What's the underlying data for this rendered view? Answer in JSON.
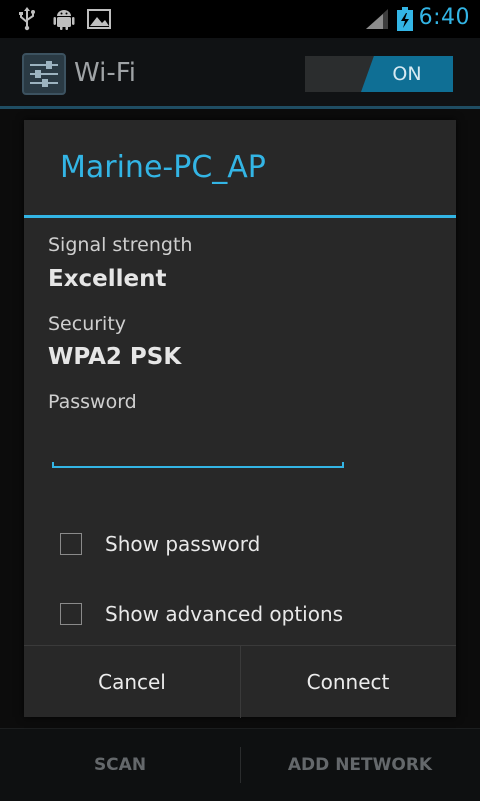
{
  "status_bar": {
    "time": "6:40",
    "icons": [
      "usb-icon",
      "android-debug-icon",
      "image-icon",
      "signal-icon",
      "battery-charging-icon"
    ]
  },
  "action_bar": {
    "title": "Wi-Fi",
    "app_icon": "wifi-settings-icon",
    "toggle_label": "ON"
  },
  "bottom_bar": {
    "scan_label": "SCAN",
    "add_network_label": "ADD NETWORK"
  },
  "dialog": {
    "title": "Marine-PC_AP",
    "signal_label": "Signal strength",
    "signal_value": "Excellent",
    "security_label": "Security",
    "security_value": "WPA2 PSK",
    "password_label": "Password",
    "password_value": "",
    "show_password_label": "Show password",
    "show_advanced_label": "Show advanced options",
    "cancel_label": "Cancel",
    "connect_label": "Connect"
  },
  "colors": {
    "accent": "#33b5e5",
    "toggle_on": "#0f6f95",
    "dialog_bg": "#282828"
  }
}
